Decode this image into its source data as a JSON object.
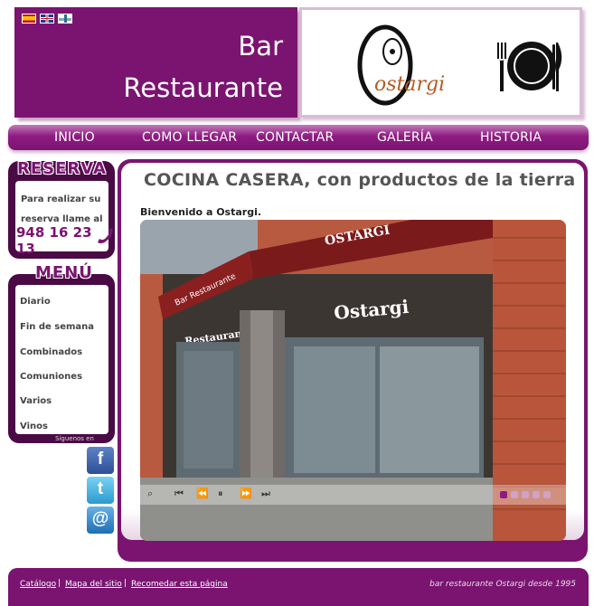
{
  "header": {
    "brand_line1": "Bar",
    "brand_line2": "Restaurante",
    "logo_text": "ostargi",
    "languages": [
      "Español",
      "English",
      "Euskara"
    ]
  },
  "nav": {
    "items": [
      "INICIO",
      "COMO LLEGAR",
      "CONTACTAR",
      "GALERÍA",
      "HISTORIA"
    ]
  },
  "reserva": {
    "title": "RESERVA",
    "text": "Para realizar su reserva llame al",
    "phone": "948 16 23 13"
  },
  "menu": {
    "title": "MENÚ",
    "items": [
      "Diario",
      "Fin de semana",
      "Combinados",
      "Comuniones",
      "Varios",
      "Vinos"
    ],
    "siguenos": "Síguenos en"
  },
  "social": [
    "facebook",
    "twitter",
    "email"
  ],
  "main": {
    "title": "COCINA CASERA, con productos de la tierra",
    "welcome": "Bienvenido a Ostargi.",
    "slide": {
      "awning_text": "OSTARGI",
      "sign_text": "Ostargi",
      "side_sign": "Restaurante",
      "awning_small": "Bar Restaurante",
      "slide_count": 5,
      "active_slide": 1
    }
  },
  "footer": {
    "links": [
      "Catálogo",
      "Mapa del sitio",
      "Recomedar esta página"
    ],
    "copyright": "bar restaurante Ostargi desde 1995"
  },
  "colors": {
    "brand_purple": "#7a1470",
    "dark_purple": "#4a0a44",
    "logo_orange": "#b45c22"
  }
}
